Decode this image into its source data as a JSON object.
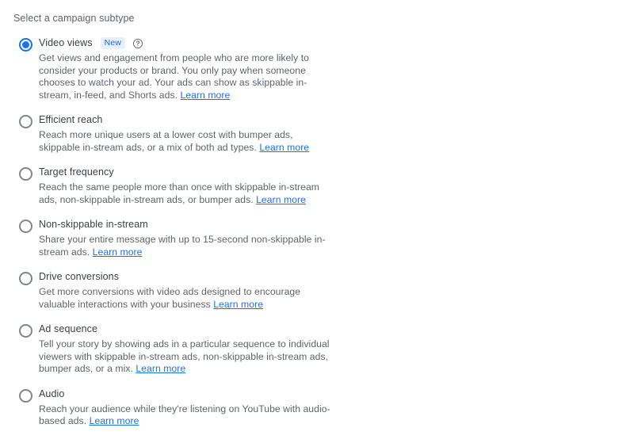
{
  "section": {
    "title": "Select a campaign subtype"
  },
  "colors": {
    "accent": "#1a73e8",
    "link": "#1a73e8",
    "badge_bg": "#e8f0fe",
    "badge_text": "#1967d2",
    "label_text": "#3c4043",
    "desc_text": "#5f6368",
    "radio_unselected": "#80868b"
  },
  "learn_more_label": "Learn more",
  "icons": {
    "help": "help-circle-icon"
  },
  "options": [
    {
      "id": "video-views",
      "label": "Video views",
      "selected": true,
      "badge": "New",
      "has_help_icon": true,
      "description": "Get views and engagement from people who are more likely to consider your products or brand. You only pay when someone chooses to watch your ad. Your ads can show as skippable in-stream, in-feed, and Shorts ads.",
      "link_inline": false
    },
    {
      "id": "efficient-reach",
      "label": "Efficient reach",
      "selected": false,
      "badge": null,
      "has_help_icon": false,
      "description": "Reach more unique users at a lower cost with bumper ads, skippable in-stream ads, or a mix of both ad types.",
      "link_inline": true
    },
    {
      "id": "target-frequency",
      "label": "Target frequency",
      "selected": false,
      "badge": null,
      "has_help_icon": false,
      "description": "Reach the same people more than once with skippable in-stream ads, non-skippable in-stream ads, or bumper ads.",
      "link_inline": true
    },
    {
      "id": "non-skippable-in-stream",
      "label": "Non-skippable in-stream",
      "selected": false,
      "badge": null,
      "has_help_icon": false,
      "description": "Share your entire message with up to 15-second non-skippable in-stream ads.",
      "link_inline": false
    },
    {
      "id": "drive-conversions",
      "label": "Drive conversions",
      "selected": false,
      "badge": null,
      "has_help_icon": false,
      "description": "Get more conversions with video ads designed to encourage valuable interactions with your business",
      "link_inline": true
    },
    {
      "id": "ad-sequence",
      "label": "Ad sequence",
      "selected": false,
      "badge": null,
      "has_help_icon": false,
      "description": "Tell your story by showing ads in a particular sequence to individual viewers with skippable in-stream ads, non-skippable in-stream ads, bumper ads, or a mix.",
      "link_inline": true
    },
    {
      "id": "audio",
      "label": "Audio",
      "selected": false,
      "badge": null,
      "has_help_icon": false,
      "description": "Reach your audience while they're listening on YouTube with audio-based ads.",
      "link_inline": false
    }
  ]
}
